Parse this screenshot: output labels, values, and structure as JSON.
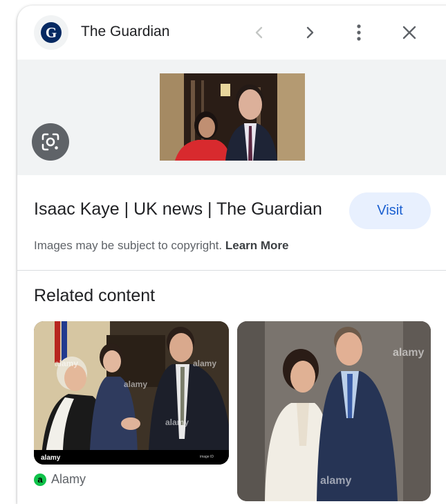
{
  "header": {
    "site_name": "The Guardian",
    "logo_letter": "G"
  },
  "result": {
    "title": "Isaac Kaye | UK news | The Guardian",
    "visit_label": "Visit",
    "copyright_text": "Images may be subject to copyright.",
    "learn_more_label": "Learn More"
  },
  "related": {
    "heading": "Related content",
    "cards": [
      {
        "source": "Alamy",
        "source_icon_letter": "a",
        "watermark": "alamy"
      },
      {
        "watermark": "alamy"
      }
    ]
  },
  "icons": {
    "back": "chevron-left-icon",
    "forward": "chevron-right-icon",
    "more": "more-vert-icon",
    "close": "close-icon",
    "lens": "google-lens-icon"
  },
  "colors": {
    "accent_blue": "#1a5fd0",
    "visit_bg": "#e8f0fe",
    "preview_bg": "#f1f3f4",
    "source_green": "#10c24a",
    "guardian_blue": "#052962"
  }
}
